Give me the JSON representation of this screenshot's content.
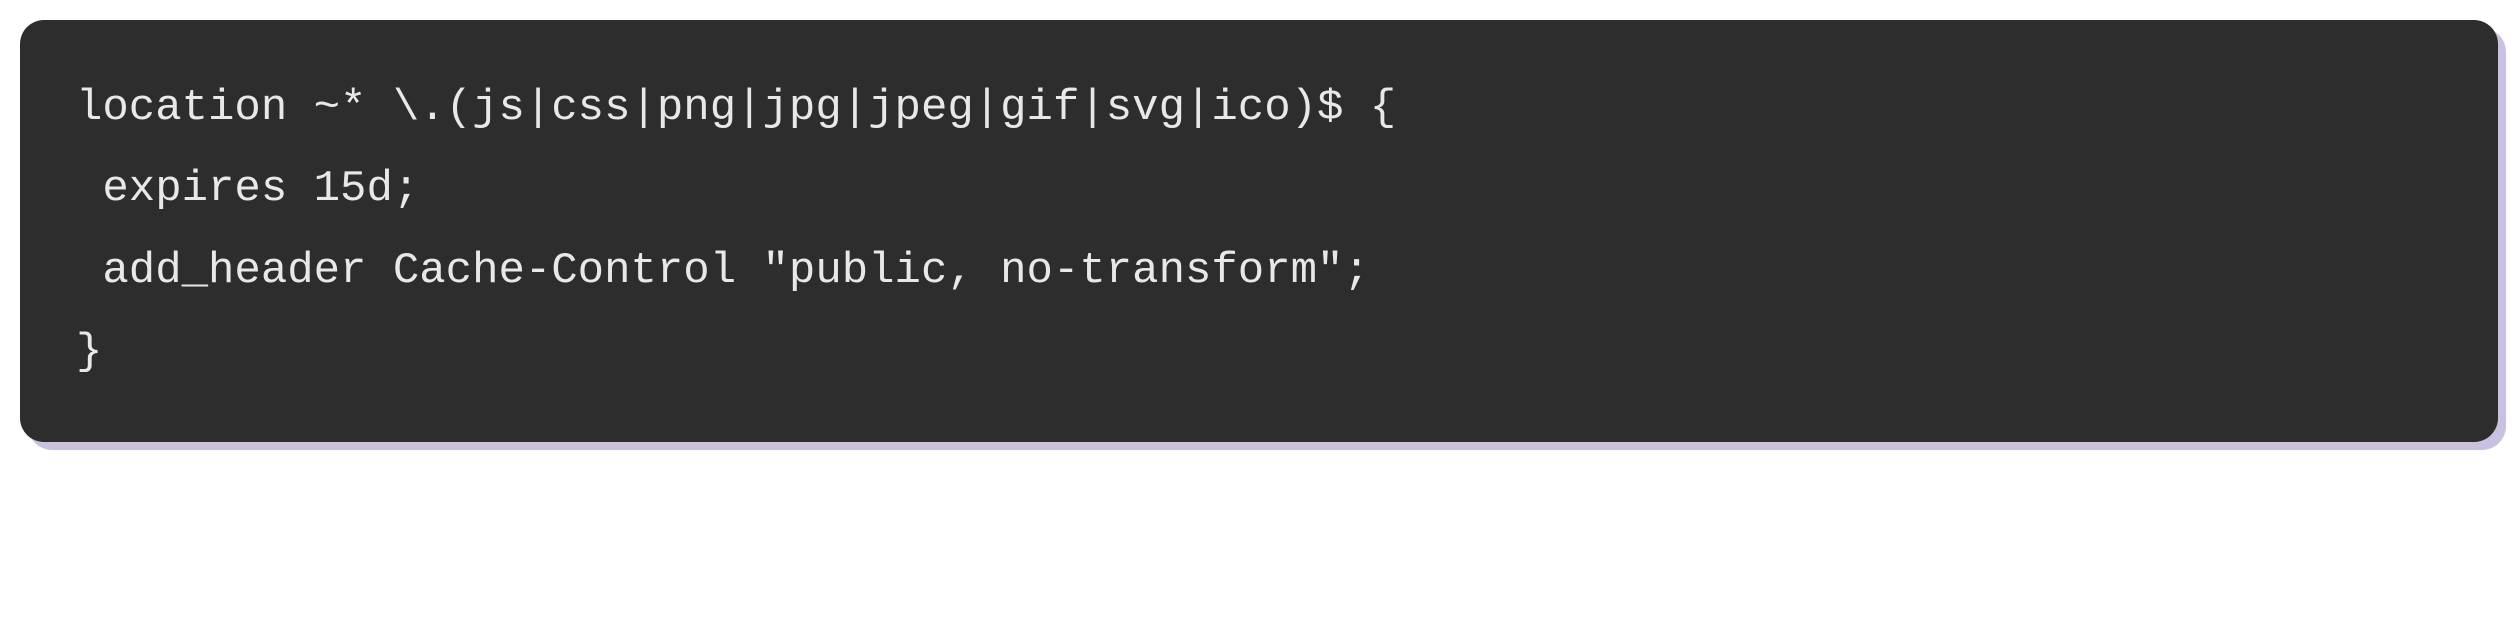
{
  "code": {
    "line1": "location ~* \\.(js|css|png|jpg|jpeg|gif|svg|ico)$ {",
    "line2": " expires 15d;",
    "line3": " add_header Cache-Control \"public, no-transform\";",
    "line4": "}"
  }
}
